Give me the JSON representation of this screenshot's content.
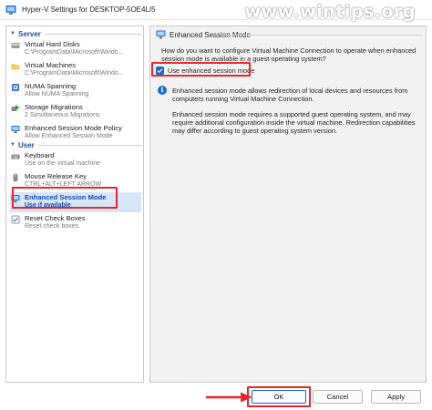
{
  "window": {
    "title": "Hyper-V Settings for DESKTOP-5OE4LI5",
    "watermark": "www.wintips.org"
  },
  "sidebar": {
    "groups": [
      {
        "label": "Server"
      },
      {
        "label": "User"
      }
    ],
    "items": [
      {
        "label": "Virtual Hard Disks",
        "sub": "C:\\ProgramData\\Microsoft\\Windo...",
        "icon": "hard-disk-icon"
      },
      {
        "label": "Virtual Machines",
        "sub": "C:\\ProgramData\\Microsoft\\Windo...",
        "icon": "folder-icon"
      },
      {
        "label": "NUMA Spanning",
        "sub": "Allow NUMA Spanning",
        "icon": "numa-icon"
      },
      {
        "label": "Storage Migrations",
        "sub": "2 Simultaneous Migrations",
        "icon": "storage-migration-icon"
      },
      {
        "label": "Enhanced Session Mode Policy",
        "sub": "Allow Enhanced Session Mode",
        "icon": "session-policy-icon"
      },
      {
        "label": "Keyboard",
        "sub": "Use on the virtual machine",
        "icon": "keyboard-icon"
      },
      {
        "label": "Mouse Release Key",
        "sub": "CTRL+ALT+LEFT ARROW",
        "icon": "mouse-icon"
      },
      {
        "label": "Enhanced Session Mode",
        "sub": "Use if available",
        "icon": "enhanced-session-icon",
        "selected": true
      },
      {
        "label": "Reset Check Boxes",
        "sub": "Reset check boxes",
        "icon": "reset-icon"
      }
    ]
  },
  "main": {
    "section_title": "Enhanced Session Mode",
    "question": "How do you want to configure Virtual Machine Connection to operate when enhanced session mode is available in a guest operating system?",
    "checkbox": {
      "label": "Use enhanced session mode",
      "checked": true
    },
    "info_para_1": "Enhanced session mode allows redirection of local devices and resources from computers running Virtual Machine Connection.",
    "info_para_2": "Enhanced session mode requires a supported guest operating system, and may require additional configuration inside the virtual machine. Redirection capabilities may differ according to guest operating system version."
  },
  "footer": {
    "ok_label": "OK",
    "cancel_label": "Cancel",
    "apply_label": "Apply"
  },
  "colors": {
    "accent": "#1467c9",
    "highlight": "#e8262a",
    "selection": "#d6e6f8",
    "group_header": "#1f4e9a"
  }
}
